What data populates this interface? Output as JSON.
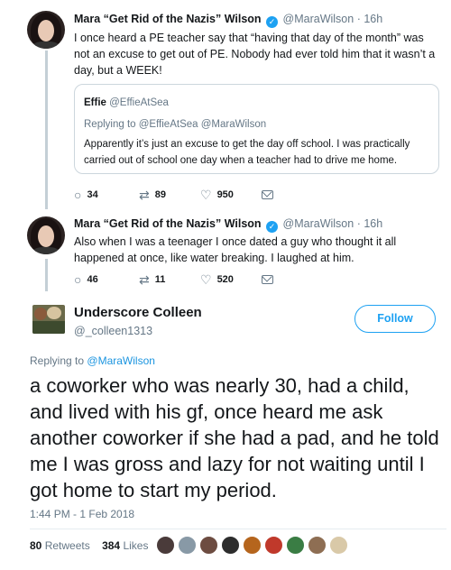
{
  "tweet1": {
    "name": "Mara “Get Rid of the Nazis” Wilson",
    "handle": "@MaraWilson",
    "dot": "·",
    "time": "16h",
    "text": "I once heard a PE teacher say that “having that day of the month” was not an excuse to get out of PE. Nobody had ever told him that it wasn’t a day, but a WEEK!",
    "quote": {
      "name": "Effie",
      "handle": "@EffieAtSea",
      "replying": "Replying to @EffieAtSea @MaraWilson",
      "text": "Apparently it’s just an excuse to get the day off school. I was practically carried out of school one day when a teacher had to drive me home."
    },
    "replies": "34",
    "retweets": "89",
    "likes": "950"
  },
  "tweet2": {
    "name": "Mara “Get Rid of the Nazis” Wilson",
    "handle": "@MaraWilson",
    "dot": "·",
    "time": "16h",
    "text": "Also when I was a teenager I once dated a guy who thought it all happened at once, like water breaking. I laughed at him.",
    "replies": "46",
    "retweets": "11",
    "likes": "520"
  },
  "main": {
    "name": "Underscore Colleen",
    "handle": "@_colleen1313",
    "follow_label": "Follow",
    "replying_prefix": "Replying to",
    "replying_to": "@MaraWilson",
    "text": "a coworker who was nearly 30, had a child, and lived with his gf, once heard me ask another coworker if she had a pad, and he told me I was gross and lazy for not waiting until I got home to start my period.",
    "timestamp": "1:44 PM - 1 Feb 2018",
    "retweets_count": "80",
    "retweets_label": "Retweets",
    "likes_count": "384",
    "likes_label": "Likes"
  },
  "icons": {
    "reply": "reply-icon",
    "retweet": "retweet-icon",
    "like": "heart-icon",
    "dm": "mail-icon",
    "verified": "verified-badge-icon"
  },
  "colors": {
    "accent": "#1da1f2",
    "muted": "#657786",
    "liker_avatars": [
      "#4a3b3a",
      "#8899a6",
      "#6d4c41",
      "#2d2d2d",
      "#b5651d",
      "#c0392b",
      "#3a7d44",
      "#8e6e53",
      "#d9c9a8"
    ]
  }
}
